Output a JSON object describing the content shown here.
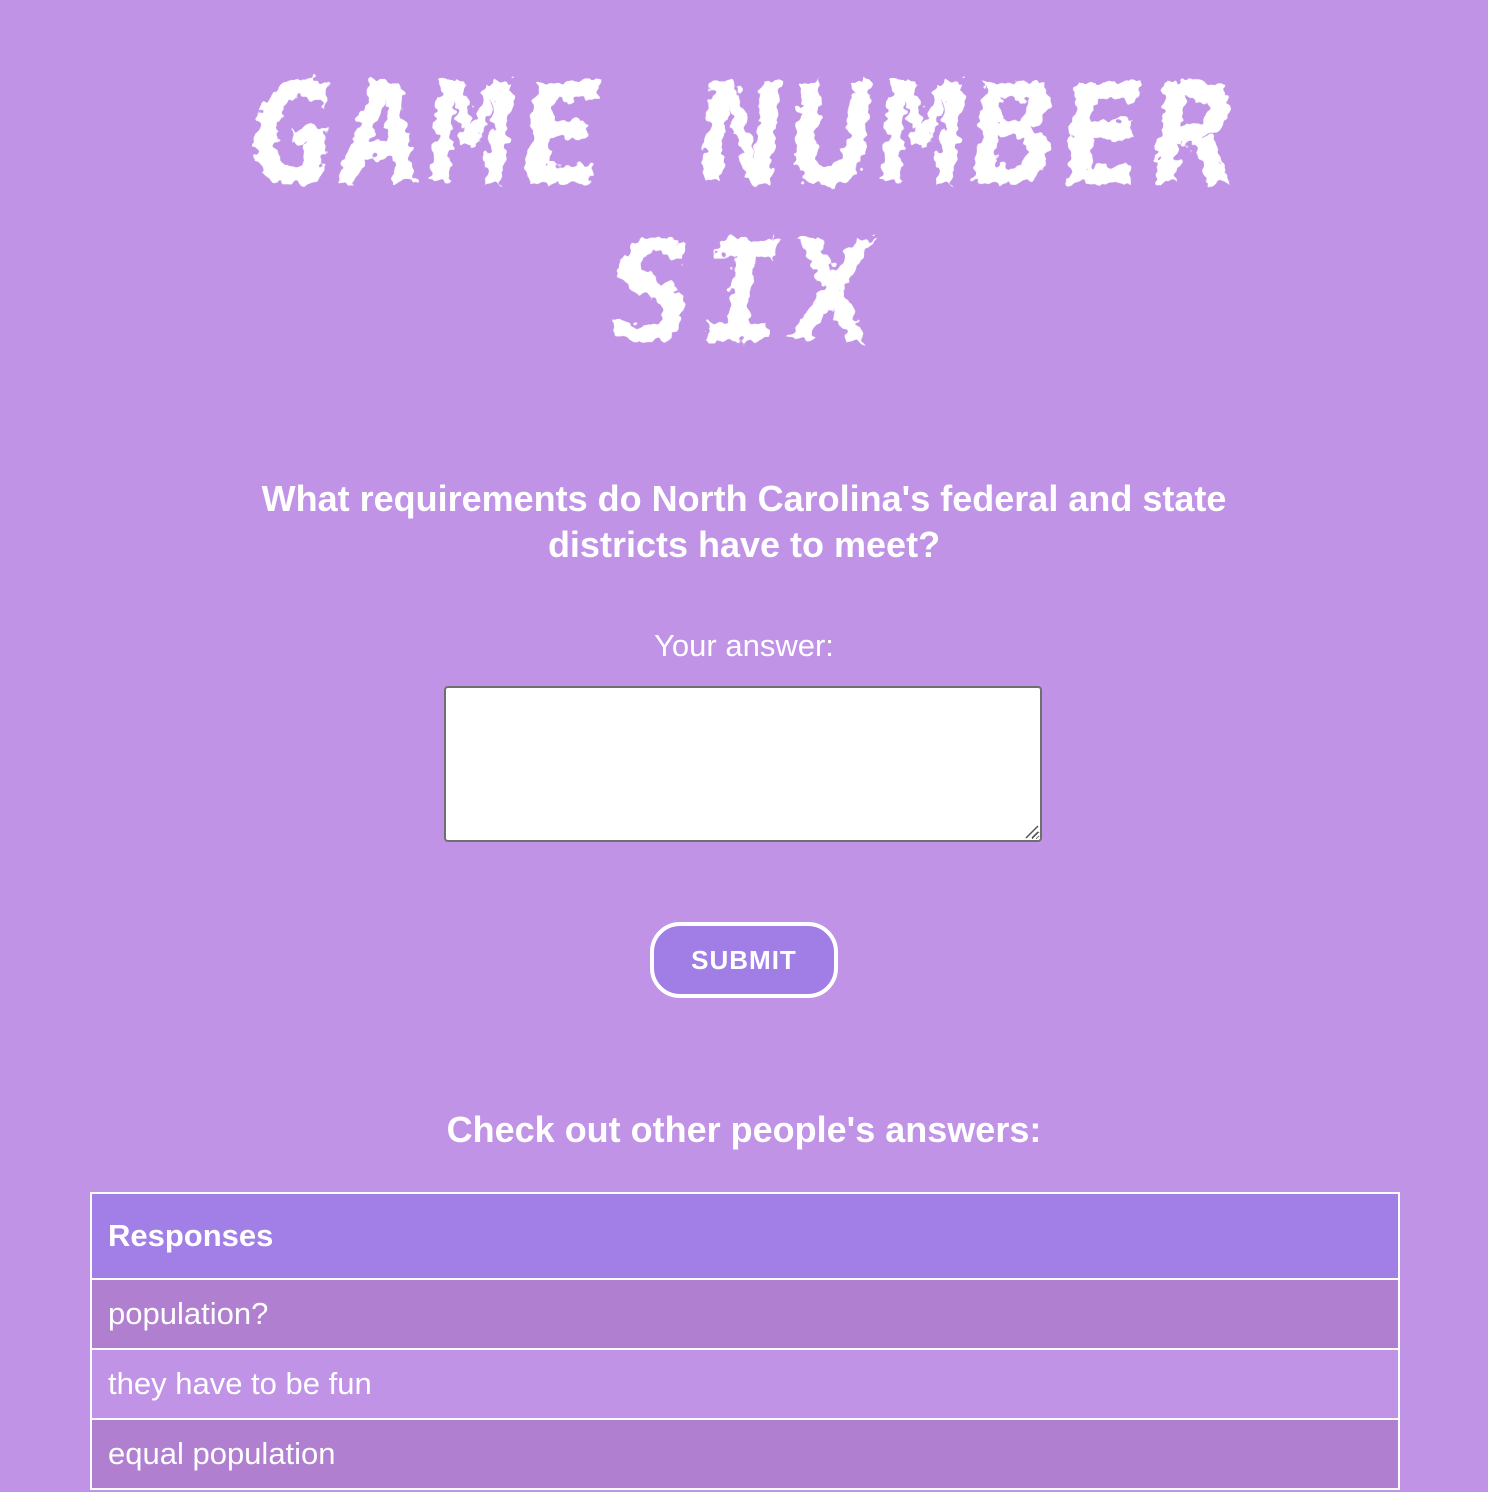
{
  "title": {
    "line1_word1": "GAME",
    "line1_word2": "NUMBER",
    "line2": "SIX"
  },
  "question": "What requirements do North Carolina's federal and state districts have to meet?",
  "answer": {
    "label": "Your answer:",
    "value": "",
    "placeholder": ""
  },
  "submit_label": "SUBMIT",
  "others_heading": "Check out other people's answers:",
  "responses_table": {
    "header": "Responses",
    "rows": [
      "population?",
      "they have to be fun",
      "equal population"
    ]
  },
  "colors": {
    "background": "#c093e6",
    "button": "#a17ee6",
    "table_header": "#a27fe6",
    "row_alt": "#b07fd0",
    "text": "#ffffff"
  }
}
